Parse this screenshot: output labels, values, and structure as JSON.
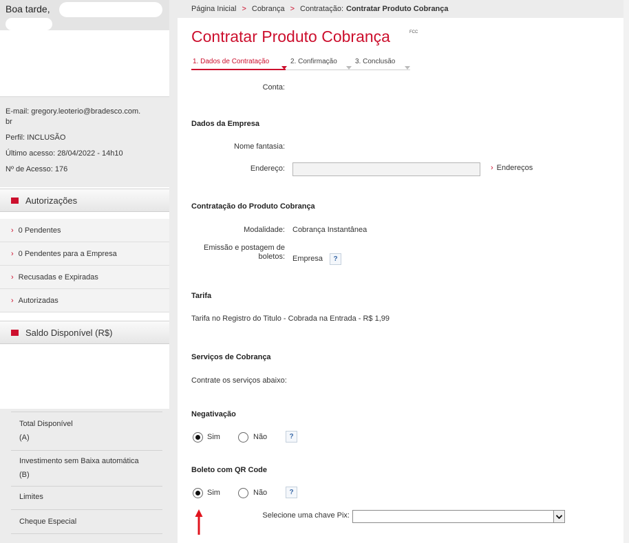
{
  "sidebar": {
    "greeting": "Boa tarde,",
    "user": {
      "email_line": "E-mail: gregory.leoterio@bradesco.com.br",
      "profile_line": "Perfil: INCLUSÃO",
      "last_access_line": "Último acesso: 28/04/2022 - 14h10",
      "access_count_line": "Nº de Acesso: 176"
    },
    "authorizations": {
      "title": "Autorizações",
      "items": [
        {
          "label": "0 Pendentes"
        },
        {
          "label": "0 Pendentes para a Empresa"
        },
        {
          "label": "Recusadas e Expiradas"
        },
        {
          "label": "Autorizadas"
        }
      ]
    },
    "balance": {
      "title": "Saldo Disponível (R$)",
      "items": [
        {
          "label": "Total Disponível",
          "sub": "(A)"
        },
        {
          "label": "Investimento sem Baixa automática",
          "sub": "(B)"
        },
        {
          "label": "Limites",
          "sub": ""
        },
        {
          "label": "Cheque Especial",
          "sub": ""
        }
      ]
    }
  },
  "breadcrumb": {
    "items": [
      "Página Inicial",
      "Cobrança"
    ],
    "current_prefix": "Contratação:",
    "current": "Contratar Produto Cobrança",
    "separator": ">"
  },
  "page": {
    "title": "Contratar Produto Cobrança",
    "title_tag": "FCC",
    "steps": [
      {
        "label": "1. Dados de Contratação",
        "active": true
      },
      {
        "label": "2. Confirmação",
        "active": false
      },
      {
        "label": "3. Conclusão",
        "active": false
      }
    ]
  },
  "form": {
    "account_label": "Conta:",
    "company": {
      "title": "Dados da Empresa",
      "trade_name_label": "Nome fantasia:",
      "address_label": "Endereço:",
      "address_value": "",
      "addresses_link": "Endereços"
    },
    "product": {
      "title": "Contratação do Produto Cobrança",
      "modality_label": "Modalidade:",
      "modality_value": "Cobrança Instantânea",
      "issuance_label_line1": "Emissão e postagem de",
      "issuance_label_line2": "boletos:",
      "issuance_value": "Empresa"
    },
    "fee": {
      "title": "Tarifa",
      "text": "Tarifa no Registro do Titulo - Cobrada na Entrada - R$ 1,99"
    },
    "services": {
      "title": "Serviços de Cobrança",
      "text": "Contrate os serviços abaixo:"
    },
    "negativation": {
      "title": "Negativação",
      "yes_label": "Sim",
      "no_label": "Não",
      "selected": "Sim"
    },
    "qr_boleto": {
      "title": "Boleto com QR Code",
      "yes_label": "Sim",
      "no_label": "Não",
      "selected": "Sim",
      "pix_key_label": "Selecione uma chave Pix:",
      "pix_key_value": ""
    },
    "help_glyph": "?"
  },
  "colors": {
    "brand_red": "#cc0f2d",
    "sidebar_bg": "#ececec",
    "annotation_arrow": "#e0141e"
  },
  "icons": {
    "section_marker": "red-square-icon",
    "list_chevron": "chevron-right-icon",
    "select_arrow": "chevron-down-icon",
    "annotation": "red-up-arrow-icon"
  }
}
